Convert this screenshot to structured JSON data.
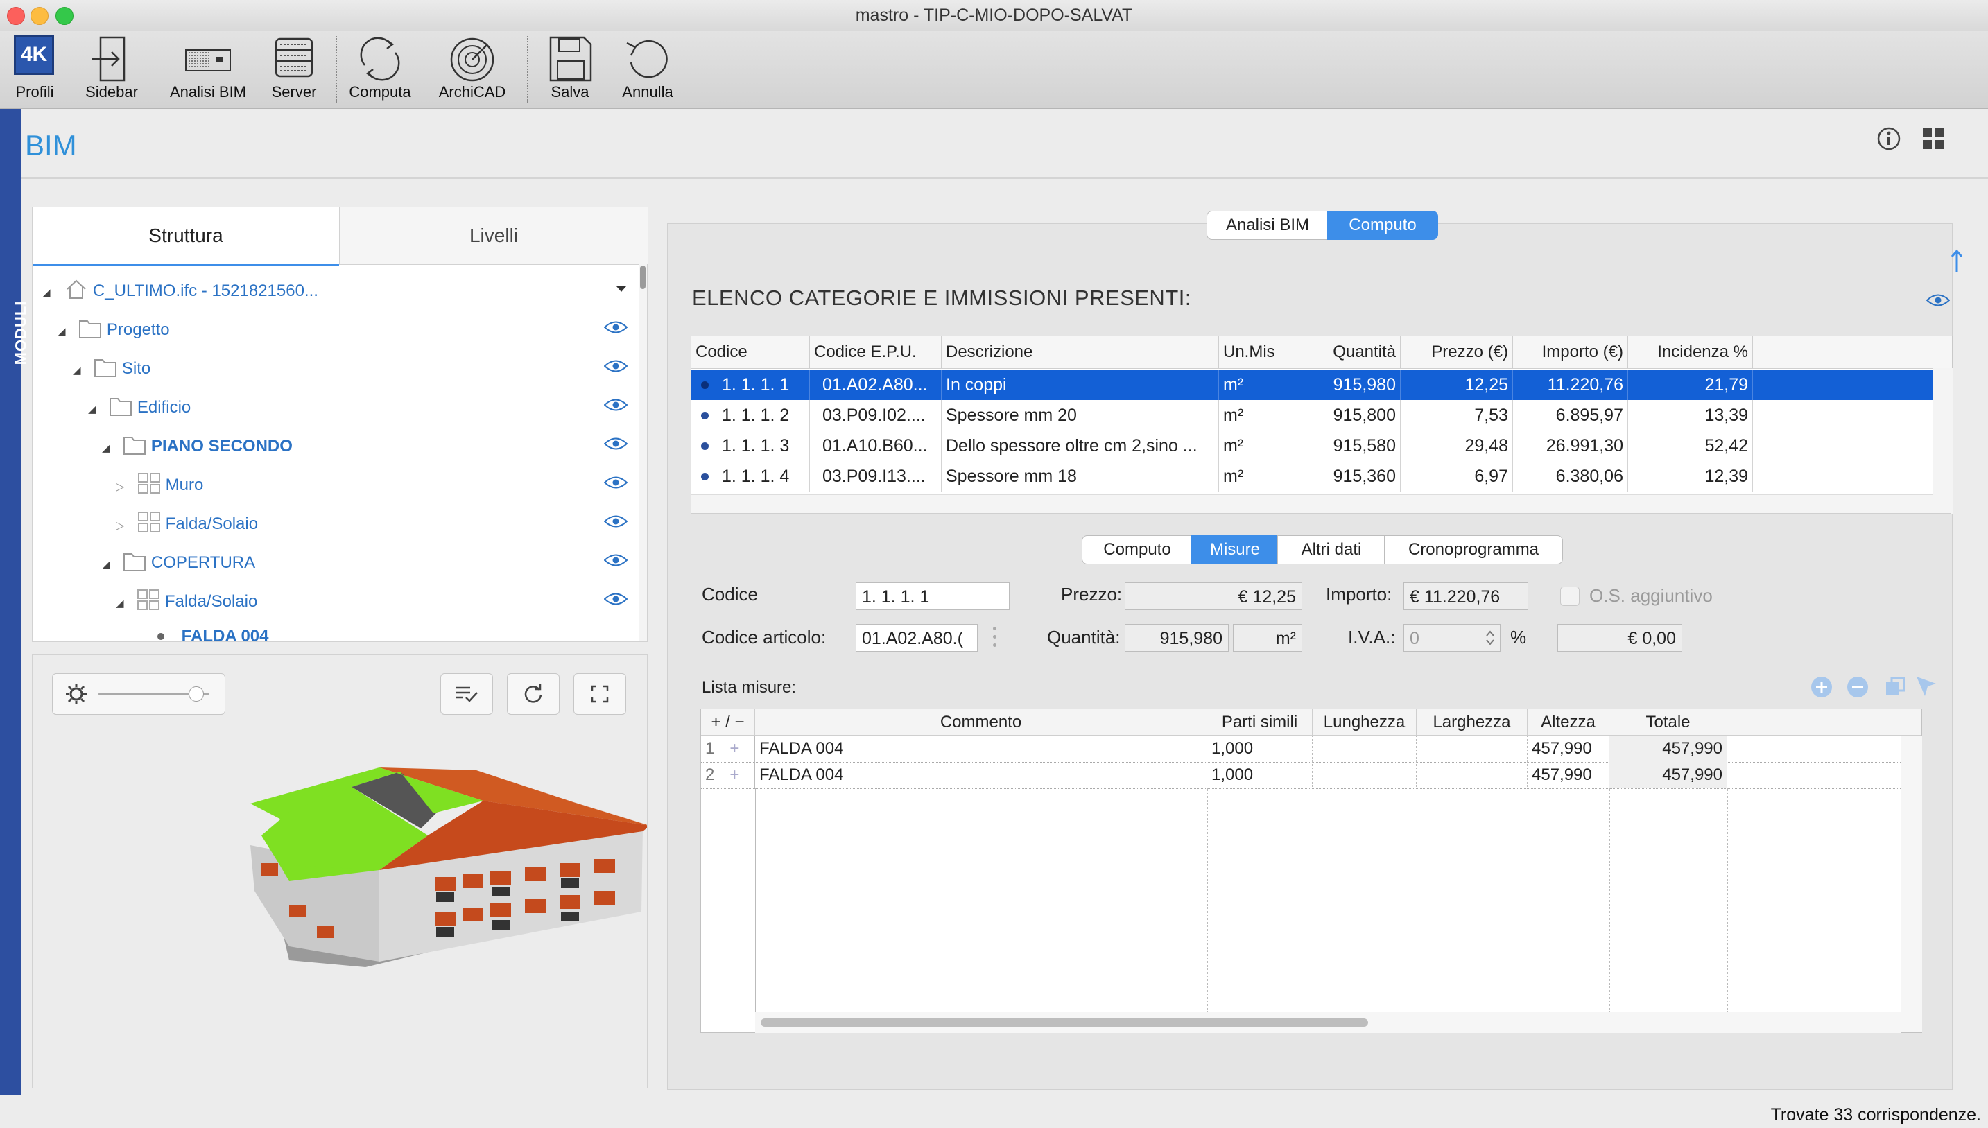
{
  "window": {
    "title": "mastro - TIP-C-MIO-DOPO-SALVAT"
  },
  "toolbar": {
    "profili_badge": "4K",
    "profili": "Profili",
    "sidebar": "Sidebar",
    "analisi_bim": "Analisi BIM",
    "server": "Server",
    "computa": "Computa",
    "archicad": "ArchiCAD",
    "salva": "Salva",
    "annulla": "Annulla"
  },
  "side_strip": {
    "label": "MODULI"
  },
  "header": {
    "title": "BIM"
  },
  "left_tabs": {
    "struttura": "Struttura",
    "livelli": "Livelli"
  },
  "tree": [
    {
      "label": "C_ULTIMO.ifc - 1521821560...",
      "icon": "home-icon"
    },
    {
      "label": "Progetto",
      "icon": "folder-icon"
    },
    {
      "label": "Sito",
      "icon": "folder-icon"
    },
    {
      "label": "Edificio",
      "icon": "folder-icon"
    },
    {
      "label": "PIANO SECONDO",
      "icon": "folder-icon"
    },
    {
      "label": "Muro",
      "icon": "grid-icon"
    },
    {
      "label": "Falda/Solaio",
      "icon": "grid-icon"
    },
    {
      "label": "COPERTURA",
      "icon": "folder-icon"
    },
    {
      "label": "Falda/Solaio",
      "icon": "grid-icon"
    },
    {
      "label": "FALDA 004",
      "icon": "bullet"
    }
  ],
  "view_tabs": {
    "analisi": "Analisi BIM",
    "computo": "Computo"
  },
  "elenco": {
    "title": "ELENCO CATEGORIE E IMMISSIONI PRESENTI:",
    "columns": [
      "Codice",
      "Codice E.P.U.",
      "Descrizione",
      "Un.Mis",
      "Quantità",
      "Prezzo (€)",
      "Importo (€)",
      "Incidenza %"
    ],
    "rows": [
      [
        "1. 1. 1. 1",
        "01.A02.A80...",
        "In coppi",
        "m²",
        "915,980",
        "12,25",
        "11.220,76",
        "21,79"
      ],
      [
        "1. 1. 1. 2",
        "03.P09.I02....",
        "Spessore mm 20",
        "m²",
        "915,800",
        "7,53",
        "6.895,97",
        "13,39"
      ],
      [
        "1. 1. 1. 3",
        "01.A10.B60...",
        "Dello spessore oltre cm 2,sino ...",
        "m²",
        "915,580",
        "29,48",
        "26.991,30",
        "52,42"
      ],
      [
        "1. 1. 1. 4",
        "03.P09.I13....",
        "Spessore mm 18",
        "m²",
        "915,360",
        "6,97",
        "6.380,06",
        "12,39"
      ]
    ]
  },
  "detail_tabs": {
    "computo": "Computo",
    "misure": "Misure",
    "altri": "Altri dati",
    "crono": "Cronoprogramma"
  },
  "form": {
    "codice_label": "Codice",
    "codice": "1. 1. 1. 1",
    "codice_articolo_label": "Codice articolo:",
    "codice_articolo": "01.A02.A80.(",
    "prezzo_label": "Prezzo:",
    "prezzo": "€  12,25",
    "quantita_label": "Quantità:",
    "quantita": "915,980",
    "unita": "m²",
    "importo_label": "Importo:",
    "importo": "€  11.220,76",
    "iva_label": "I.V.A.:",
    "iva": "0",
    "iva_percent": "%",
    "os_label": "O.S. aggiuntivo",
    "iva_amount": "€  0,00"
  },
  "misure": {
    "title": "Lista misure:",
    "columns": [
      "+ / −",
      "Commento",
      "Parti simili",
      "Lunghezza",
      "Larghezza",
      "Altezza",
      "Totale"
    ],
    "rows": [
      {
        "n": "1",
        "commento": "FALDA 004",
        "parti": "1,000",
        "lunghezza": "",
        "larghezza": "",
        "altezza": "457,990",
        "totale": "457,990"
      },
      {
        "n": "2",
        "commento": "FALDA 004",
        "parti": "1,000",
        "lunghezza": "",
        "larghezza": "",
        "altezza": "457,990",
        "totale": "457,990"
      }
    ]
  },
  "status": {
    "text": "Trovate 33 corrispondenze."
  },
  "colors": {
    "accent": "#3d8ee9",
    "selection": "#1360d6",
    "title": "#2f90d9",
    "tree_text": "#2b72c4",
    "strip": "#2d4fa0"
  }
}
